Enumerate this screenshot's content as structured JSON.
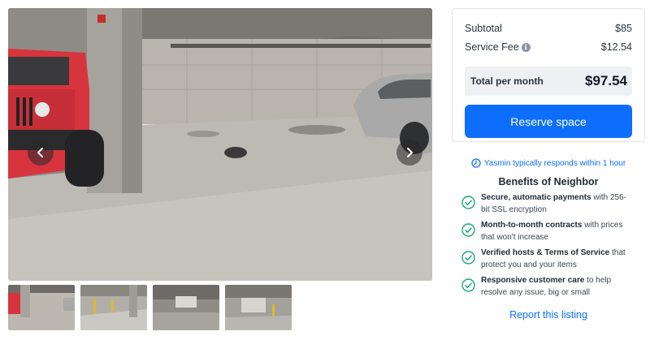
{
  "gallery": {
    "prev_icon": "chevron-left-icon",
    "next_icon": "chevron-right-icon",
    "thumbnail_count": 4
  },
  "pricing": {
    "subtotal_label": "Subtotal",
    "subtotal_value": "$85",
    "fee_label": "Service Fee",
    "fee_info_icon": "info-icon",
    "fee_value": "$12.54",
    "total_label": "Total per month",
    "total_value": "$97.54",
    "reserve_label": "Reserve space"
  },
  "host": {
    "response_icon": "clock-icon",
    "response_text": "Yasmin typically responds within 1 hour"
  },
  "benefits": {
    "title": "Benefits of Neighbor",
    "items": [
      {
        "bold": "Secure, automatic payments",
        "rest": " with 256-bit SSL encryption"
      },
      {
        "bold": "Month-to-month contracts",
        "rest": " with prices that won't increase"
      },
      {
        "bold": "Verified hosts & Terms of Service",
        "rest": " that protect you and your items"
      },
      {
        "bold": "Responsive customer care",
        "rest": " to help resolve any issue, big or small"
      }
    ]
  },
  "report_label": "Report this listing",
  "colors": {
    "accent": "#0d6efd",
    "check": "#19a974",
    "total_bg": "#eef0f3"
  }
}
